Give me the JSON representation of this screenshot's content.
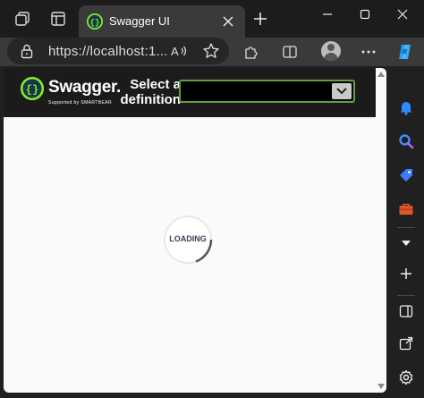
{
  "browser": {
    "tab": {
      "title": "Swagger UI"
    },
    "address": {
      "url": "https://localhost:1..."
    }
  },
  "swagger": {
    "logo_name": "Swagger.",
    "logo_subtitle": "Supported by SMARTBEAR",
    "select_label": "Select a definition",
    "selected_definition": ""
  },
  "content": {
    "loading_text": "LOADING"
  },
  "colors": {
    "swagger_green": "#85ea2d",
    "topbar": "#1b1b1b",
    "select_border": "#62a03f"
  }
}
